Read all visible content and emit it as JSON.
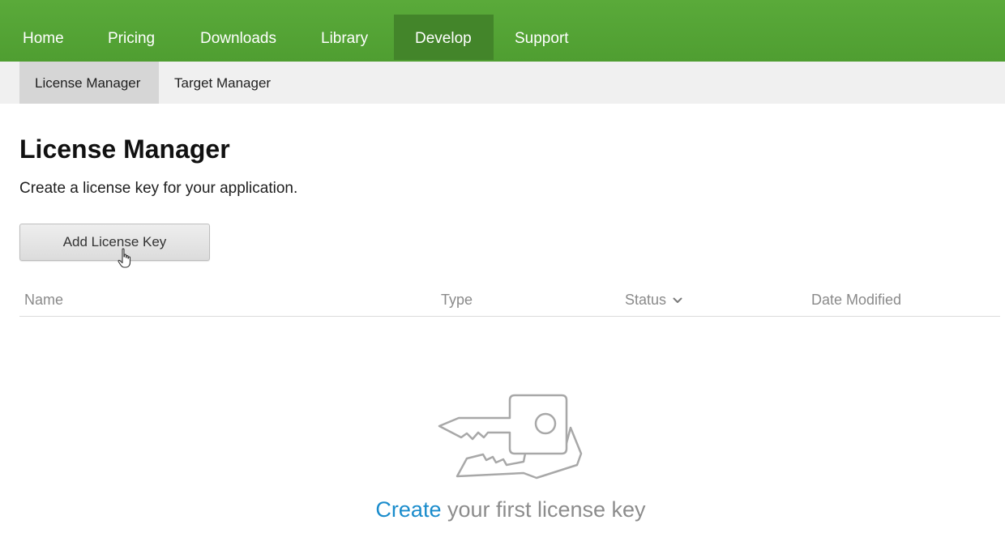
{
  "topnav": {
    "items": [
      {
        "label": "Home"
      },
      {
        "label": "Pricing"
      },
      {
        "label": "Downloads"
      },
      {
        "label": "Library"
      },
      {
        "label": "Develop",
        "active": true
      },
      {
        "label": "Support"
      }
    ],
    "color": "#55a536",
    "active_color": "#43852a"
  },
  "subnav": {
    "items": [
      {
        "label": "License Manager",
        "active": true
      },
      {
        "label": "Target Manager"
      }
    ]
  },
  "main": {
    "title": "License Manager",
    "description": "Create a license key for your application.",
    "add_button_label": "Add License Key"
  },
  "table": {
    "columns": [
      {
        "label": "Name"
      },
      {
        "label": "Type"
      },
      {
        "label": "Status",
        "sort_icon": "chevron-down-icon"
      },
      {
        "label": "Date Modified"
      }
    ],
    "rows": []
  },
  "empty_state": {
    "icon": "keys-icon",
    "link_text": "Create",
    "message": " your first license key",
    "link_color": "#1a8ccc"
  }
}
